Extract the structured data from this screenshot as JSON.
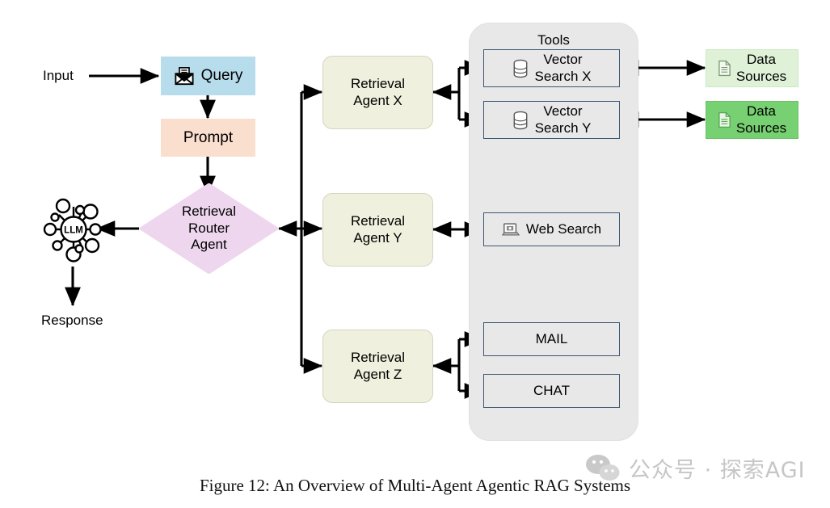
{
  "figure": {
    "caption": "Figure 12: An Overview of Multi-Agent Agentic RAG Systems"
  },
  "watermark": {
    "text": "公众号 · 探索AGI",
    "logo_icon": "wechat-icon",
    "color": "#c6c6c6"
  },
  "flow": {
    "input_label": "Input",
    "response_label": "Response",
    "llm_label": "LLM",
    "llm_icon": "llm-network-icon"
  },
  "nodes": {
    "query": {
      "label": "Query",
      "icon": "envelope-mail-icon",
      "fill": "#b7dceb"
    },
    "prompt": {
      "label": "Prompt",
      "fill": "#fadfcf"
    },
    "router": {
      "line1": "Retrieval",
      "line2": "Router",
      "line3": "Agent",
      "fill": "#eed6ee"
    }
  },
  "agents": [
    {
      "line1": "Retrieval",
      "line2": "Agent X",
      "fill": "#eff0dd"
    },
    {
      "line1": "Retrieval",
      "line2": "Agent Y",
      "fill": "#eff0dd"
    },
    {
      "line1": "Retrieval",
      "line2": "Agent Z",
      "fill": "#eff0dd"
    }
  ],
  "tools": {
    "panel_label": "Tools",
    "panel_fill": "#e8e8e8",
    "items": [
      {
        "line1": "Vector",
        "line2": "Search X",
        "icon": "database-icon",
        "two_line": true
      },
      {
        "line1": "Vector",
        "line2": "Search Y",
        "icon": "database-icon",
        "two_line": true
      },
      {
        "line1": "Web Search",
        "line2": "",
        "icon": "monitor-screen-icon",
        "two_line": false
      },
      {
        "line1": "MAIL",
        "line2": "",
        "icon": "",
        "two_line": false
      },
      {
        "line1": "CHAT",
        "line2": "",
        "icon": "",
        "two_line": false
      }
    ]
  },
  "data_sources": [
    {
      "line1": "Data",
      "line2": "Sources",
      "icon": "document-icon",
      "fill": "#dff2d8"
    },
    {
      "line1": "Data",
      "line2": "Sources",
      "icon": "document-icon",
      "fill": "#77d072"
    }
  ]
}
